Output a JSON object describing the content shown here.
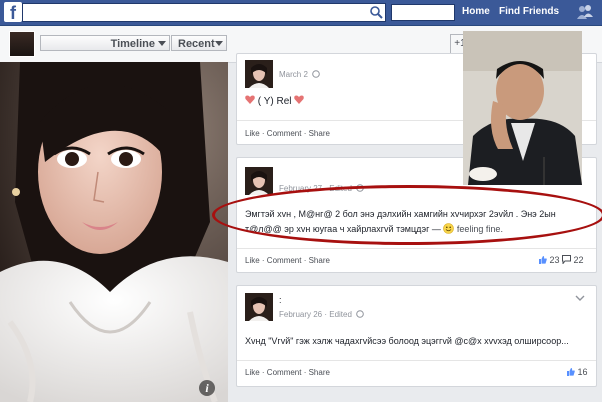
{
  "topbar": {
    "logo": "f",
    "search_value": "",
    "user_field_value": "",
    "home": "Home",
    "find_friends": "Find Friends"
  },
  "profile_bar": {
    "timeline": "Timeline",
    "recent": "Recent",
    "extra_button": "+1"
  },
  "photo": {
    "info_glyph": "i"
  },
  "posts": [
    {
      "date": "March 2",
      "text": "( Y) Rel",
      "actions": [
        "Like",
        "Comment",
        "Share"
      ]
    },
    {
      "date": "February 27 · Edited",
      "text_line1": "Эмгтэй хvн , М@нг@ 2 бол энэ дэлхийн хамгийн хvчирхэг 2эvйл . Энэ 2ын",
      "text_line2": "т@л@@ эр хvн юугаа ч хайрлахгvй тэмцдэг —",
      "feeling": "feeling fine.",
      "actions": [
        "Like",
        "Comment",
        "Share"
      ],
      "likes": "23",
      "comments": "22"
    },
    {
      "name": ":",
      "date": "February 26 · Edited",
      "text": "Хvнд \"Vгvй\" гэж хэлж чадахгvйсээ болоод эцэггvй @с@х хvvхэд олширсоор...",
      "actions": [
        "Like",
        "Comment",
        "Share"
      ],
      "likes": "16"
    }
  ],
  "colors": {
    "brand": "#3b5998",
    "highlight_oval": "#a7100f"
  },
  "icons": [
    "search-icon",
    "friends-icon",
    "heart-icon",
    "globe-icon",
    "smiley-icon",
    "like-icon",
    "comment-icon",
    "chevron-down-icon",
    "info-icon"
  ]
}
